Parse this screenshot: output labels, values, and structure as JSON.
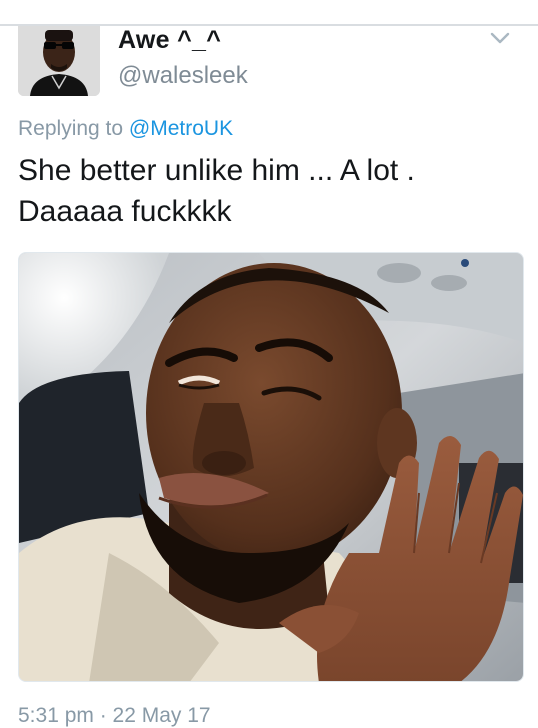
{
  "tweet": {
    "display_name": "Awe ^_^",
    "handle": "@walesleek",
    "replying_prefix": "Replying to ",
    "replying_to": "@MetroUK",
    "text": "She better unlike him ... A lot . Daaaaa fuckkkk",
    "timestamp": "5:31 pm · 22 May 17"
  },
  "icons": {
    "menu": "chevron-down-icon"
  },
  "colors": {
    "text": "#14171a",
    "secondary": "#8899a6",
    "link": "#1b95e0",
    "divider": "#d9dde1"
  }
}
